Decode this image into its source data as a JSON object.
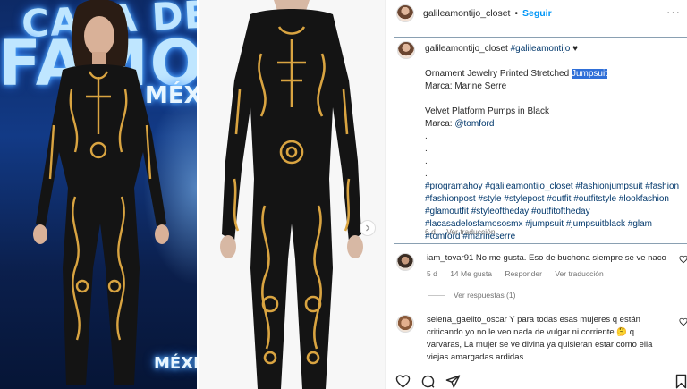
{
  "header": {
    "username": "galileamontijo_closet",
    "separator": "•",
    "follow_label": "Seguir",
    "more_label": "···"
  },
  "media": {
    "left_photo_text": [
      "CASA DE LOS",
      "FAMOSOS",
      "MÉXI",
      "MÉXIC"
    ]
  },
  "caption": {
    "username": "galileamontijo_closet",
    "tag_user": "#galileamontijo",
    "heart": "♥",
    "title_prefix": "Ornament Jewelry Printed Stretched ",
    "title_highlight": "Jumpsuit",
    "brand1": "Marca: Marine Serre",
    "product2": "Velvet Platform Pumps in Black",
    "brand2_prefix": "Marca: ",
    "brand2_tag": "@tomford",
    "dots": [
      ".",
      ".",
      ".",
      "."
    ],
    "hashtag_lines": [
      "#programahoy #galileamontijo_closet #fashionjumpsuit #fashion",
      "#fashionpost #style #stylepost #outfit #outfitstyle #lookfashion",
      "#glamoutfit #styleoftheday #outfitoftheday",
      "#lacasadelosfamososmx #jumpsuit #jumpsuitblack #glam",
      "#tomford #marineserre"
    ],
    "time": "6 d",
    "translation": "Ver traducción"
  },
  "comments": [
    {
      "username": "iam_tovar91",
      "text": "No me gusta. Eso de buchona siempre se ve naco",
      "time": "5 d",
      "likes": "14 Me gusta",
      "reply": "Responder",
      "translation": "Ver traducción",
      "view_replies": "Ver respuestas (1)"
    },
    {
      "username": "selena_gaelito_oscar",
      "text_lines": [
        "Y para todas esas mujeres q están",
        "criticando yo no le veo nada de vulgar ni corriente 🤔 q",
        "varvaras, La mujer se ve divina ya quisieran estar como ella",
        "viejas amargadas ardidas"
      ]
    }
  ],
  "colors": {
    "link": "#00376b",
    "follow": "#0095f6",
    "highlight": "#2f6fd8",
    "muted": "#737373",
    "jumpsuit": "#141414",
    "ornament": "#d9a441"
  },
  "icons": [
    "heart-icon",
    "comment-icon",
    "share-icon",
    "bookmark-icon",
    "chevron-right-icon",
    "more-icon"
  ]
}
